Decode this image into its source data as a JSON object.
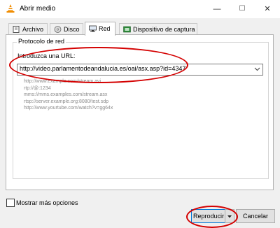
{
  "window": {
    "title": "Abrir medio",
    "minimize_glyph": "—",
    "maximize_glyph": "☐",
    "close_glyph": "✕"
  },
  "tabs": [
    {
      "label": "Archivo",
      "icon": "file-icon",
      "active": false
    },
    {
      "label": "Disco",
      "icon": "disc-icon",
      "active": false
    },
    {
      "label": "Red",
      "icon": "network-icon",
      "active": true
    },
    {
      "label": "Dispositivo de captura",
      "icon": "capture-device-icon",
      "active": false
    }
  ],
  "network": {
    "group_title": "Protocolo de red",
    "url_label": "Introduzca una URL:",
    "url_value": "http://video.parlamentodeandalucia.es/oai/asx.asp?id=4347",
    "examples": [
      "http://www.example.com/stream.avi",
      "rtp://@:1234",
      "mms://mms.examples.com/stream.asx",
      "rtsp://server.example.org:8080/test.sdp",
      "http://www.yourtube.com/watch?v=gg64x"
    ]
  },
  "footer": {
    "more_options_label": "Mostrar más opciones",
    "play_label": "Reproducir",
    "cancel_label": "Cancelar"
  },
  "colors": {
    "annotation": "#d40000",
    "focus_border": "#0078d7",
    "vlc_orange": "#f08c00"
  }
}
